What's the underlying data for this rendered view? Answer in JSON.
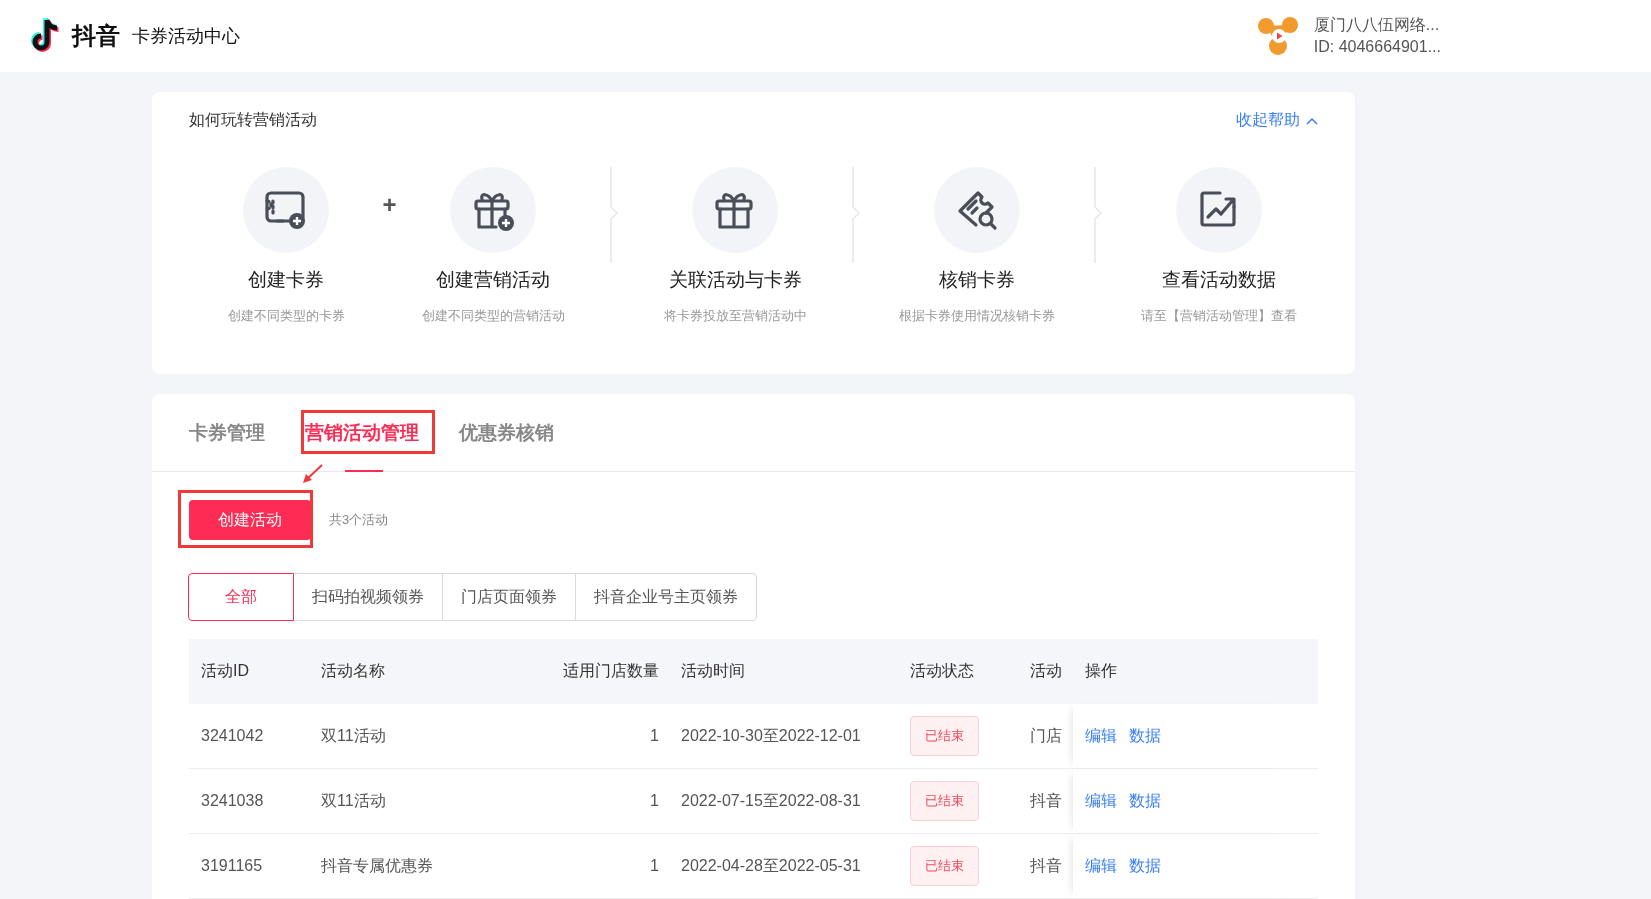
{
  "header": {
    "brand": "抖音",
    "title": "卡券活动中心",
    "account": {
      "name": "厦门八八伍网络...",
      "id": "ID: 4046664901..."
    }
  },
  "help": {
    "title": "如何玩转营销活动",
    "toggle": "收起帮助",
    "steps": [
      {
        "kind": "card",
        "label": "创建卡券",
        "desc": "创建不同类型的卡券"
      },
      {
        "kind": "gift-add",
        "plus": "+",
        "label": "创建营销活动",
        "desc": "创建不同类型的营销活动"
      },
      {
        "kind": "gift",
        "divider": true,
        "label": "关联活动与卡券",
        "desc": "将卡券投放至营销活动中"
      },
      {
        "kind": "verify",
        "divider": true,
        "label": "核销卡券",
        "desc": "根据卡券使用情况核销卡券"
      },
      {
        "kind": "chart",
        "divider": true,
        "label": "查看活动数据",
        "desc": "请至【营销活动管理】查看"
      }
    ]
  },
  "tabs": [
    {
      "label": "卡券管理",
      "selected": false,
      "annotated": false
    },
    {
      "label": "营销活动管理",
      "selected": true,
      "annotated": true
    },
    {
      "label": "优惠券核销",
      "selected": false,
      "annotated": false
    }
  ],
  "create_button": {
    "label": "创建活动",
    "annotated": true
  },
  "count": "共3个活动",
  "filters": [
    {
      "label": "全部",
      "selected": true
    },
    {
      "label": "扫码拍视频领券",
      "selected": false
    },
    {
      "label": "门店页面领券",
      "selected": false
    },
    {
      "label": "抖音企业号主页领券",
      "selected": false
    }
  ],
  "table": {
    "columns": [
      "活动ID",
      "活动名称",
      "适用门店数量",
      "活动时间",
      "活动状态",
      "活动",
      "操作"
    ],
    "rows": [
      {
        "id": "3241042",
        "name": "双11活动",
        "stores": "1",
        "time": "2022-10-30至2022-12-01",
        "status": "已结束",
        "column_6": "门店",
        "actions": [
          "编辑",
          "数据"
        ]
      },
      {
        "id": "3241038",
        "name": "双11活动",
        "stores": "1",
        "time": "2022-07-15至2022-08-31",
        "status": "已结束",
        "column_6": "抖音",
        "actions": [
          "编辑",
          "数据"
        ]
      },
      {
        "id": "3191165",
        "name": "抖音专属优惠券",
        "stores": "1",
        "time": "2022-04-28至2022-05-31",
        "status": "已结束",
        "column_6": "抖音",
        "actions": [
          "编辑",
          "数据"
        ]
      }
    ]
  }
}
